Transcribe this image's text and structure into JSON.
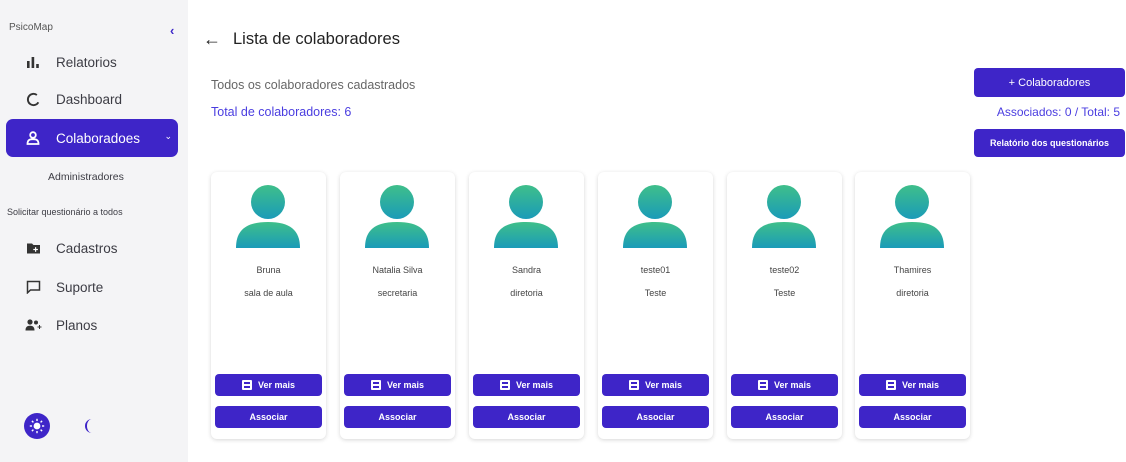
{
  "sidebar": {
    "brand": "PsicoMap",
    "collapse_icon": "chevron-left-icon",
    "items": [
      {
        "label": "Relatorios",
        "icon": "bar-chart-icon"
      },
      {
        "label": "Dashboard",
        "icon": "circle-icon"
      },
      {
        "label": "Colaboradoes",
        "icon": "user-icon"
      },
      {
        "label": "Cadastros",
        "icon": "folder-plus-icon"
      },
      {
        "label": "Suporte",
        "icon": "chat-icon"
      },
      {
        "label": "Planos",
        "icon": "user-group-icon"
      }
    ],
    "sub_item": "Administradores",
    "solicitar": "Solicitar questionário a todos",
    "theme": {
      "sun_icon": "sun-icon",
      "moon_icon": "moon-icon"
    }
  },
  "header": {
    "back_icon": "arrow-left-icon",
    "title": "Lista de colaboradores",
    "subtitle": "Todos os colaboradores cadastrados",
    "total": "Total de colaboradores: 6"
  },
  "actions": {
    "add_button": "+ Colaboradores",
    "associated_counter": "Associados: 0 / Total: 5",
    "report_button": "Relatório dos questionários"
  },
  "cards": [
    {
      "name": "Bruna",
      "role": "sala de aula"
    },
    {
      "name": "Natalia Silva",
      "role": "secretaria"
    },
    {
      "name": "Sandra",
      "role": "diretoria"
    },
    {
      "name": "teste01",
      "role": "Teste"
    },
    {
      "name": "teste02",
      "role": "Teste"
    },
    {
      "name": "Thamires",
      "role": "diretoria"
    }
  ],
  "card_buttons": {
    "ver_mais": "Ver mais",
    "associar": "Associar"
  },
  "colors": {
    "accent": "#3e25c8",
    "link": "#4a3de0",
    "avatar_top": "#3fbf8a",
    "avatar_bottom": "#1a9bb8"
  }
}
